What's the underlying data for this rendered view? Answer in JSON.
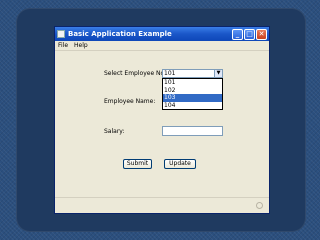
{
  "window": {
    "title": "Basic Application Example",
    "controls": {
      "minimize": "_",
      "maximize": "□",
      "close": "✕"
    }
  },
  "menu": {
    "items": [
      "File",
      "Help"
    ]
  },
  "form": {
    "employee_label": "Select Employee No:",
    "selected_employee": "101",
    "employee_options": [
      "101",
      "102",
      "103",
      "104"
    ],
    "highlighted_option": "103",
    "name_label": "Employee Name:",
    "salary_label": "Salary:",
    "salary_value": ""
  },
  "buttons": {
    "submit": "Submit",
    "update": "Update"
  },
  "icons": {
    "title_icon": "java-window-icon",
    "dropdown_icon": "chevron-down-icon",
    "status_icon": "circle-icon"
  },
  "colors": {
    "titlebar": "#1a56c8",
    "window_bg": "#ece9d8",
    "selection": "#316ac5",
    "slide_bg": "#2b4f7e"
  }
}
